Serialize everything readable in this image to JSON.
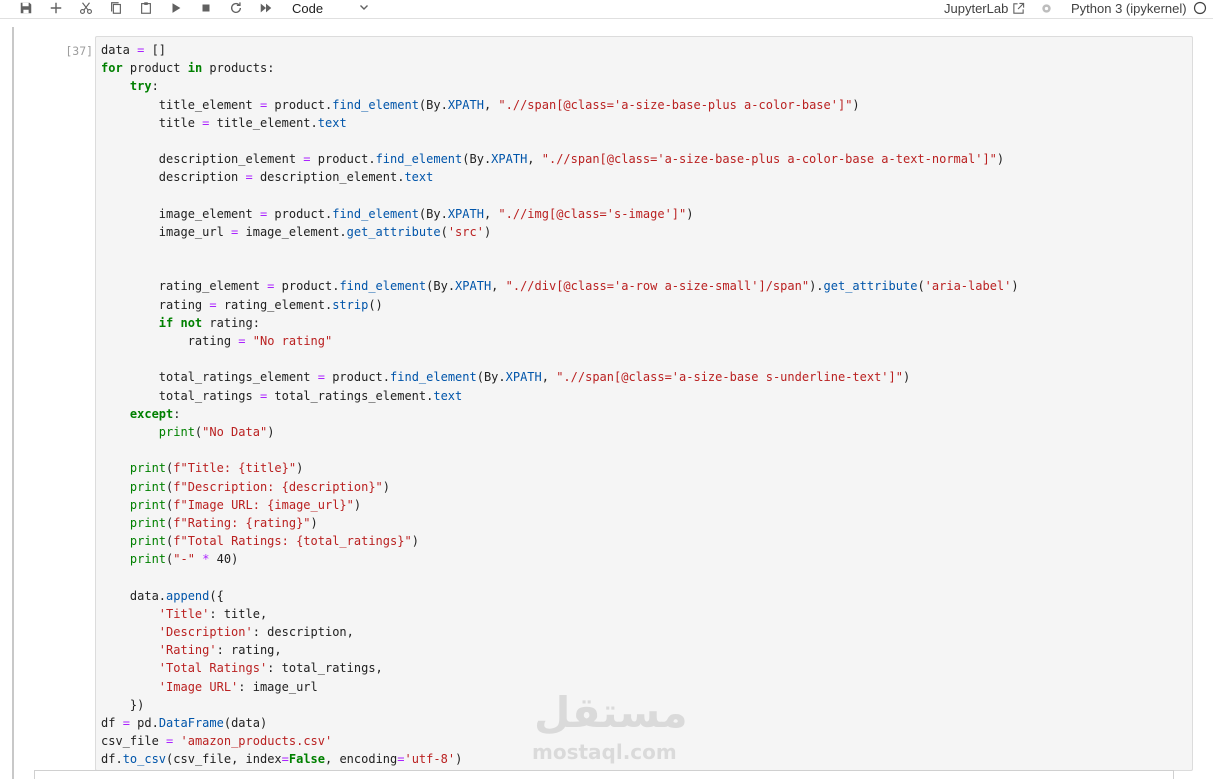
{
  "toolbar": {
    "cell_type": "Code",
    "jupyterlab_link": "JupyterLab",
    "kernel_name": "Python 3 (ipykernel)",
    "icons": [
      "save-icon",
      "add-cell-icon",
      "cut-icon",
      "copy-icon",
      "paste-icon",
      "run-icon",
      "stop-icon",
      "restart-icon",
      "fast-forward-icon",
      "chevron-down-icon",
      "external-link-icon",
      "settings-icon",
      "kernel-status-icon"
    ]
  },
  "cell": {
    "prompt": "[37]:",
    "code_lines": [
      "data = []",
      "for product in products:",
      "    try:",
      "        title_element = product.find_element(By.XPATH, \".//span[@class='a-size-base-plus a-color-base']\")",
      "        title = title_element.text",
      "",
      "        description_element = product.find_element(By.XPATH, \".//span[@class='a-size-base-plus a-color-base a-text-normal']\")",
      "        description = description_element.text",
      "",
      "        image_element = product.find_element(By.XPATH, \".//img[@class='s-image']\")",
      "        image_url = image_element.get_attribute('src')",
      "",
      "",
      "        rating_element = product.find_element(By.XPATH, \".//div[@class='a-row a-size-small']/span\").get_attribute('aria-label')",
      "        rating = rating_element.strip()",
      "        if not rating:",
      "            rating = \"No rating\"",
      "",
      "        total_ratings_element = product.find_element(By.XPATH, \".//span[@class='a-size-base s-underline-text']\")",
      "        total_ratings = total_ratings_element.text",
      "    except:",
      "        print(\"No Data\")",
      "",
      "    print(f\"Title: {title}\")",
      "    print(f\"Description: {description}\")",
      "    print(f\"Image URL: {image_url}\")",
      "    print(f\"Rating: {rating}\")",
      "    print(f\"Total Ratings: {total_ratings}\")",
      "    print(\"-\" * 40)",
      "",
      "    data.append({",
      "        'Title': title,",
      "        'Description': description,",
      "        'Rating': rating,",
      "        'Total Ratings': total_ratings,",
      "        'Image URL': image_url",
      "    })",
      "df = pd.DataFrame(data)",
      "csv_file = 'amazon_products.csv'",
      "df.to_csv(csv_file, index=False, encoding='utf-8')"
    ]
  },
  "watermark": {
    "arabic": "مستقل",
    "latin": "mostaql.com"
  }
}
